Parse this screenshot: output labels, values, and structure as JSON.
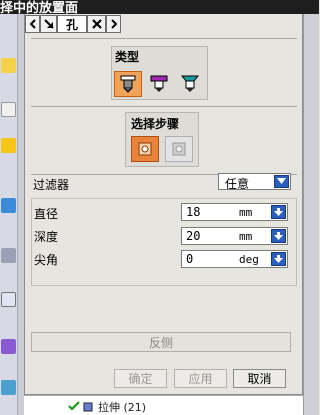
{
  "window": {
    "title_partial": "择中的放置面"
  },
  "tabs": {
    "back_icon": "chevron-left-icon",
    "arrow_icon": "diagonal-arrow-icon",
    "title": "孔",
    "close_icon": "close-icon",
    "forward_icon": "chevron-right-icon"
  },
  "type_group": {
    "label": "类型",
    "options": [
      "simple-hole-icon",
      "counterbore-hole-icon",
      "countersink-hole-icon"
    ],
    "selected_index": 0
  },
  "step_group": {
    "label": "选择步骤",
    "steps": [
      "placement-face-step-icon",
      "through-face-step-icon"
    ],
    "selected_index": 0
  },
  "filter": {
    "label": "过滤器",
    "value": "任意"
  },
  "params": [
    {
      "label": "直径",
      "value": "18",
      "unit": "mm"
    },
    {
      "label": "深度",
      "value": "20",
      "unit": "mm"
    },
    {
      "label": "尖角",
      "value": "0",
      "unit": "deg"
    }
  ],
  "reverse_button": "反侧",
  "buttons": {
    "ok": "确定",
    "apply": "应用",
    "cancel": "取消"
  },
  "tree": {
    "item": "拉伸 (21)"
  },
  "colors": {
    "accent_orange": "#f0a25a",
    "dropdown_blue": "#2a5fbd"
  }
}
